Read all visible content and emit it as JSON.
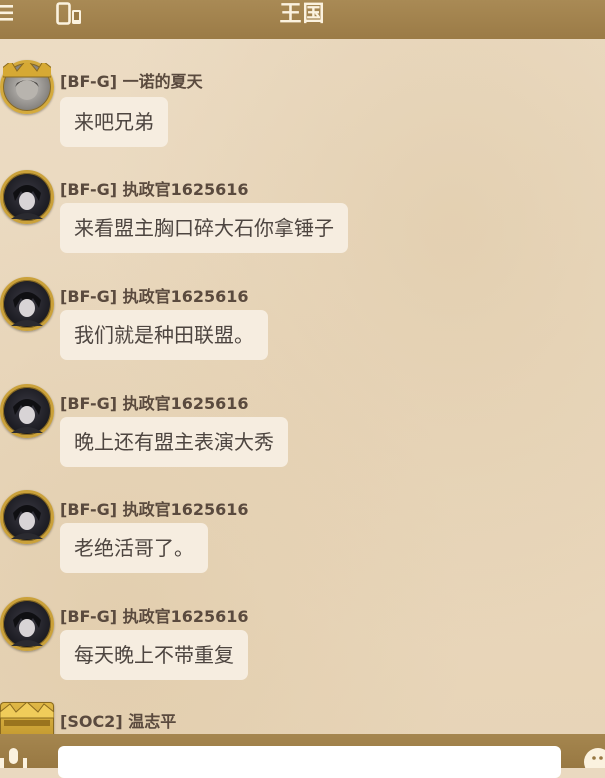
{
  "header": {
    "title": "王国",
    "menu_icon": "menu-icon",
    "device_icon": "device-switch-icon"
  },
  "messages": [
    {
      "sender": "[BF-G] 一诺的夏天",
      "text": "来吧兄弟",
      "avatar": "avatar-gold-crown-frame"
    },
    {
      "sender": "[BF-G] 执政官1625616",
      "text": "来看盟主胸口碎大石你拿锤子",
      "avatar": "avatar-gold-ring"
    },
    {
      "sender": "[BF-G] 执政官1625616",
      "text": "我们就是种田联盟。",
      "avatar": "avatar-gold-ring"
    },
    {
      "sender": "[BF-G] 执政官1625616",
      "text": "晚上还有盟主表演大秀",
      "avatar": "avatar-gold-ring"
    },
    {
      "sender": "[BF-G] 执政官1625616",
      "text": "老绝活哥了。",
      "avatar": "avatar-gold-ring"
    },
    {
      "sender": "[BF-G] 执政官1625616",
      "text": "每天晚上不带重复",
      "avatar": "avatar-gold-ring"
    },
    {
      "sender": "[SOC2] 温志平",
      "text": "",
      "avatar": "avatar-gold-crown-frame"
    }
  ],
  "composer": {
    "input_value": "",
    "mic_icon": "microphone-icon",
    "emoji_icon": "emoji-icon"
  },
  "colors": {
    "bar": "#a98a55",
    "bubble": "#f6ede0",
    "sender": "#5a4a3e",
    "frame": "#caa13a"
  }
}
